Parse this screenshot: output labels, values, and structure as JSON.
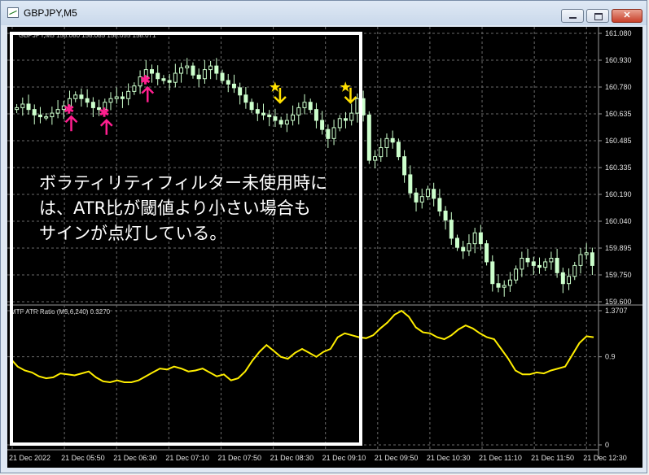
{
  "window": {
    "title": "GBPJPY,M5"
  },
  "chart": {
    "info_line": "GBPJPY,M5  158.080 158.085 158.055 158.071",
    "price_ticks": [
      "161.080",
      "160.930",
      "160.780",
      "160.635",
      "160.485",
      "160.335",
      "160.190",
      "160.040",
      "159.895",
      "159.750",
      "159.600"
    ],
    "indicator_label": "MTF ATR Ratio  (M5,6,240) 0.3270",
    "indicator_ticks": [
      "1.3707",
      "0.9",
      "0"
    ],
    "time_labels": [
      "21 Dec 2022",
      "21 Dec 05:50",
      "21 Dec 06:30",
      "21 Dec 07:10",
      "21 Dec 07:50",
      "21 Dec 08:30",
      "21 Dec 09:10",
      "21 Dec 09:50",
      "21 Dec 10:30",
      "21 Dec 11:10",
      "21 Dec 11:50",
      "21 Dec 12:30"
    ],
    "colors": {
      "background": "#000000",
      "candle": "#ccffcc",
      "buy_signal": "#ff1f8f",
      "sell_signal": "#ffe000",
      "indicator": "#ffee00",
      "grid": "#6a6a6a"
    }
  },
  "annotation": {
    "text": "ボラティリティフィルター未使用時に\nは、ATR比が閾値より小さい場合も\nサインが点灯している。"
  },
  "chart_data": {
    "type": "candlestick",
    "price_axis": {
      "min": 159.6,
      "max": 161.08
    },
    "closes": [
      160.67,
      160.69,
      160.66,
      160.63,
      160.62,
      160.62,
      160.64,
      160.66,
      160.68,
      160.72,
      160.74,
      160.72,
      160.7,
      160.67,
      160.66,
      160.7,
      160.72,
      160.73,
      160.72,
      160.76,
      160.79,
      160.84,
      160.88,
      160.86,
      160.83,
      160.82,
      160.81,
      160.86,
      160.89,
      160.9,
      160.85,
      160.83,
      160.88,
      160.9,
      160.86,
      160.82,
      160.8,
      160.78,
      160.74,
      160.7,
      160.66,
      160.64,
      160.63,
      160.62,
      160.6,
      160.58,
      160.6,
      160.63,
      160.67,
      160.7,
      160.66,
      160.6,
      160.55,
      160.5,
      160.56,
      160.61,
      160.6,
      160.64,
      160.72,
      160.63,
      160.38,
      160.4,
      160.45,
      160.5,
      160.48,
      160.4,
      160.3,
      160.2,
      160.15,
      160.18,
      160.22,
      160.17,
      160.1,
      160.05,
      159.95,
      159.9,
      159.88,
      159.92,
      159.98,
      159.92,
      159.82,
      159.7,
      159.68,
      159.69,
      159.72,
      159.78,
      159.84,
      159.82,
      159.8,
      159.79,
      159.82,
      159.84,
      159.76,
      159.7,
      159.74,
      159.8,
      159.86,
      159.87,
      159.8
    ],
    "buy_signal_indices": [
      9,
      15,
      22
    ],
    "sell_signal_indices": [
      44,
      56
    ],
    "indicator": {
      "name": "MTF ATR Ratio",
      "min": 0,
      "max": 1.3707,
      "values": [
        0.88,
        0.8,
        0.76,
        0.74,
        0.7,
        0.68,
        0.69,
        0.73,
        0.72,
        0.71,
        0.73,
        0.75,
        0.69,
        0.65,
        0.64,
        0.66,
        0.64,
        0.64,
        0.66,
        0.7,
        0.74,
        0.78,
        0.77,
        0.8,
        0.78,
        0.75,
        0.76,
        0.78,
        0.74,
        0.7,
        0.72,
        0.66,
        0.68,
        0.75,
        0.86,
        0.95,
        1.02,
        0.96,
        0.9,
        0.88,
        0.94,
        0.98,
        0.94,
        0.9,
        0.95,
        0.98,
        1.1,
        1.14,
        1.12,
        1.1,
        1.09,
        1.12,
        1.19,
        1.25,
        1.33,
        1.37,
        1.31,
        1.2,
        1.15,
        1.14,
        1.1,
        1.08,
        1.12,
        1.18,
        1.22,
        1.19,
        1.14,
        1.1,
        1.08,
        0.98,
        0.88,
        0.76,
        0.72,
        0.72,
        0.74,
        0.73,
        0.76,
        0.78,
        0.8,
        0.92,
        1.04,
        1.11,
        1.1
      ]
    }
  }
}
